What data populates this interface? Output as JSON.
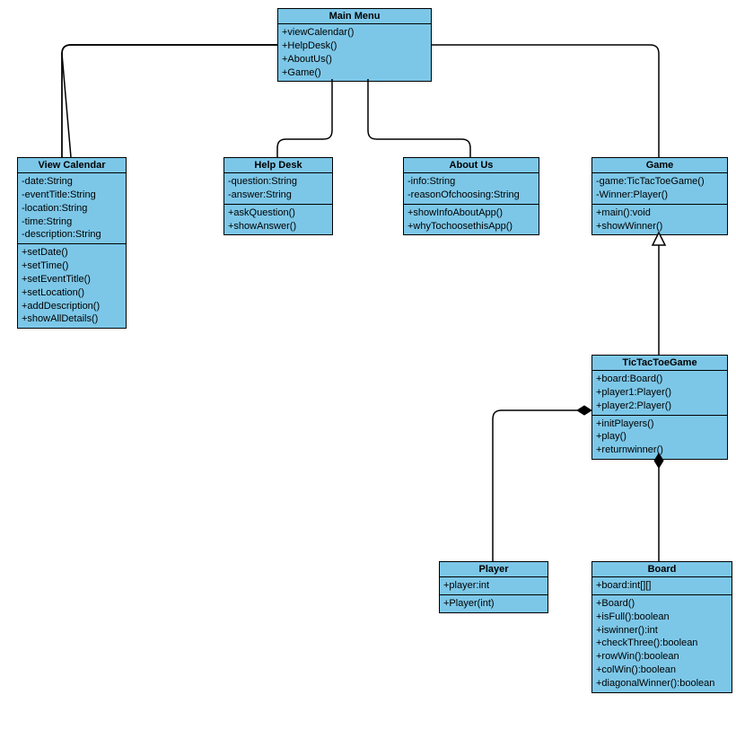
{
  "classes": {
    "mainMenu": {
      "title": "Main Menu",
      "methods": [
        "+viewCalendar()",
        "+HelpDesk()",
        "+AboutUs()",
        "+Game()"
      ]
    },
    "viewCalendar": {
      "title": "View Calendar",
      "attrs": [
        "-date:String",
        "-eventTitle:String",
        "-location:String",
        "-time:String",
        "-description:String"
      ],
      "methods": [
        "+setDate()",
        "+setTime()",
        "+setEventTitle()",
        "+setLocation()",
        "+addDescription()",
        "+showAllDetails()"
      ]
    },
    "helpDesk": {
      "title": "Help Desk",
      "attrs": [
        "-question:String",
        "-answer:String"
      ],
      "methods": [
        "+askQuestion()",
        "+showAnswer()"
      ]
    },
    "aboutUs": {
      "title": "About Us",
      "attrs": [
        "-info:String",
        "-reasonOfchoosing:String"
      ],
      "methods": [
        "+showInfoAboutApp()",
        "+whyTochoosethisApp()"
      ]
    },
    "game": {
      "title": "Game",
      "attrs": [
        "-game:TicTacToeGame()",
        "-Winner:Player()"
      ],
      "methods": [
        "+main():void",
        "+showWinner()"
      ]
    },
    "ticTacToe": {
      "title": "TicTacToeGame",
      "attrs": [
        "+board:Board()",
        "+player1:Player()",
        "+player2:Player()"
      ],
      "methods": [
        "+initPlayers()",
        "+play()",
        "+returnwinner()"
      ]
    },
    "player": {
      "title": "Player",
      "attrs": [
        "+player:int"
      ],
      "methods": [
        "+Player(int)"
      ]
    },
    "board": {
      "title": "Board",
      "attrs": [
        "+board:int[][]"
      ],
      "methods": [
        "+Board()",
        "+isFull():boolean",
        "+iswinner():int",
        "+checkThree():boolean",
        "+rowWin():boolean",
        "+colWin():boolean",
        "+diagonalWinner():boolean"
      ]
    }
  }
}
